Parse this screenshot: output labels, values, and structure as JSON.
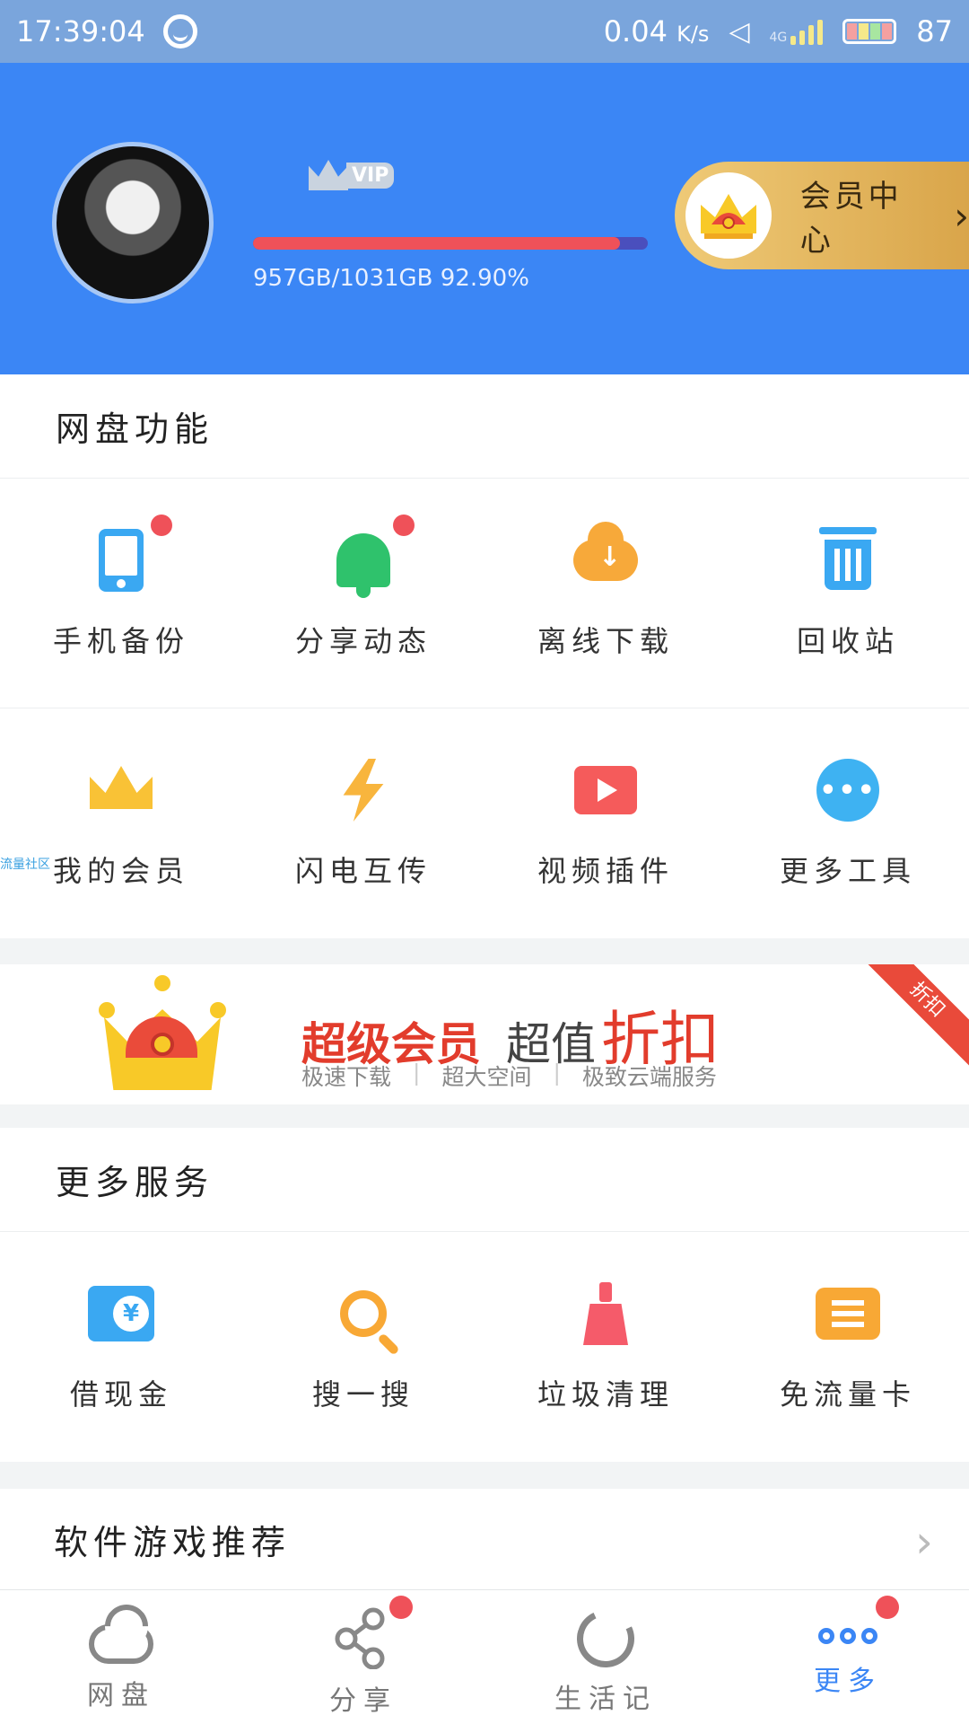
{
  "status_bar": {
    "time": "17:39:04",
    "speed": "0.04",
    "speed_unit": "K/s",
    "network": "4G",
    "battery": "87"
  },
  "header": {
    "vip_tag": "VIP",
    "quota_text": "957GB/1031GB  92.90%",
    "quota_fraction": 0.929,
    "member_center_label": "会员中心"
  },
  "disk_functions": {
    "title": "网盘功能",
    "items": [
      {
        "label": "手机备份",
        "icon": "phone-icon",
        "badge": true
      },
      {
        "label": "分享动态",
        "icon": "bell-icon",
        "badge": true
      },
      {
        "label": "离线下载",
        "icon": "cloud-download-icon",
        "badge": false
      },
      {
        "label": "回收站",
        "icon": "trash-icon",
        "badge": false
      },
      {
        "label": "我的会员",
        "icon": "crown-icon",
        "badge": false
      },
      {
        "label": "闪电互传",
        "icon": "lightning-icon",
        "badge": false
      },
      {
        "label": "视频插件",
        "icon": "play-icon",
        "badge": false
      },
      {
        "label": "更多工具",
        "icon": "more-icon",
        "badge": false
      }
    ]
  },
  "side_label": "流量社区",
  "banner": {
    "title_1": "超级会员",
    "title_2": "超值",
    "title_3": "折扣",
    "sub_1": "极速下载",
    "sub_2": "超大空间",
    "sub_3": "极致云端服务",
    "separator": "|",
    "ribbon": "折扣"
  },
  "more_services": {
    "title": "更多服务",
    "items": [
      {
        "label": "借现金",
        "icon": "cash-icon"
      },
      {
        "label": "搜一搜",
        "icon": "search-icon"
      },
      {
        "label": "垃圾清理",
        "icon": "broom-icon"
      },
      {
        "label": "免流量卡",
        "icon": "sim-card-icon"
      }
    ]
  },
  "recommend": {
    "title": "软件游戏推荐"
  },
  "bottom_nav": [
    {
      "label": "网盘",
      "icon": "cloud-icon",
      "active": false,
      "badge": false
    },
    {
      "label": "分享",
      "icon": "share-icon",
      "active": false,
      "badge": true
    },
    {
      "label": "生活记",
      "icon": "refresh-icon",
      "active": false,
      "badge": false
    },
    {
      "label": "更多",
      "icon": "dots-icon",
      "active": true,
      "badge": true
    }
  ],
  "colors": {
    "header_blue": "#3b86f5",
    "badge_red": "#ef5159",
    "member_gold": "#e3b560"
  }
}
